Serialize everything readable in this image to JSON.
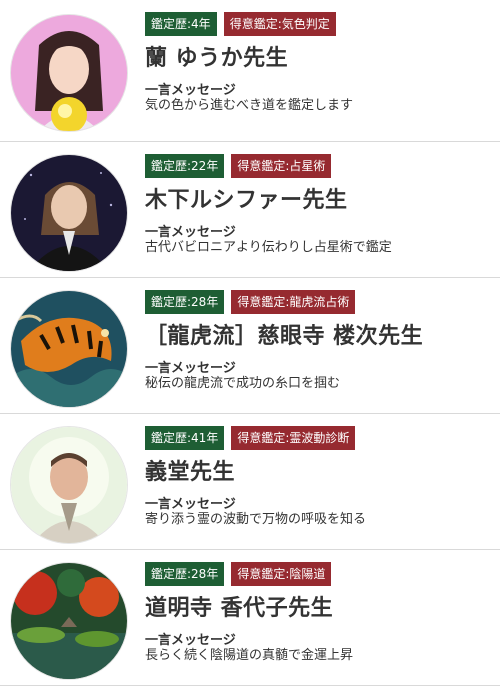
{
  "fortune_tellers": [
    {
      "career_badge": "鑑定歴:4年",
      "specialty_badge": "得意鑑定:気色判定",
      "name": "蘭 ゆうか先生",
      "message_label": "一言メッセージ",
      "message": "気の色から進むべき道を鑑定します"
    },
    {
      "career_badge": "鑑定歴:22年",
      "specialty_badge": "得意鑑定:占星術",
      "name": "木下ルシファー先生",
      "message_label": "一言メッセージ",
      "message": "古代バビロニアより伝わりし占星術で鑑定"
    },
    {
      "career_badge": "鑑定歴:28年",
      "specialty_badge": "得意鑑定:龍虎流占術",
      "name": "［龍虎流］慈眼寺 楼次先生",
      "message_label": "一言メッセージ",
      "message": "秘伝の龍虎流で成功の糸口を掴む"
    },
    {
      "career_badge": "鑑定歴:41年",
      "specialty_badge": "得意鑑定:霊波動診断",
      "name": "義堂先生",
      "message_label": "一言メッセージ",
      "message": "寄り添う霊の波動で万物の呼吸を知る"
    },
    {
      "career_badge": "鑑定歴:28年",
      "specialty_badge": "得意鑑定:陰陽道",
      "name": "道明寺 香代子先生",
      "message_label": "一言メッセージ",
      "message": "長らく続く陰陽道の真髄で金運上昇"
    }
  ],
  "colors": {
    "career_badge_bg": "#1e5e34",
    "specialty_badge_bg": "#962a30"
  }
}
